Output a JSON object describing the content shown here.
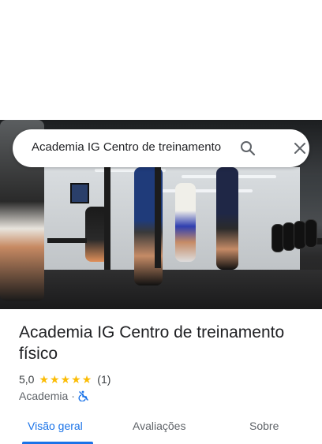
{
  "search": {
    "query": "Academia IG Centro de treinamento"
  },
  "place": {
    "title": "Academia IG Centro de treinamento físico",
    "rating": "5,0",
    "review_count": "(1)",
    "stars_filled": 5,
    "category": "Academia",
    "separator": "·"
  },
  "tabs": [
    {
      "label": "Visão geral",
      "active": true
    },
    {
      "label": "Avaliações",
      "active": false
    },
    {
      "label": "Sobre",
      "active": false
    }
  ],
  "icons": {
    "search": "search-icon",
    "close": "close-icon",
    "accessibility": "wheelchair-not-accessible-icon",
    "star": "star-icon"
  },
  "colors": {
    "accent": "#1a73e8",
    "star": "#fbbc04",
    "text": "#202124",
    "secondary_text": "#5f6368"
  }
}
